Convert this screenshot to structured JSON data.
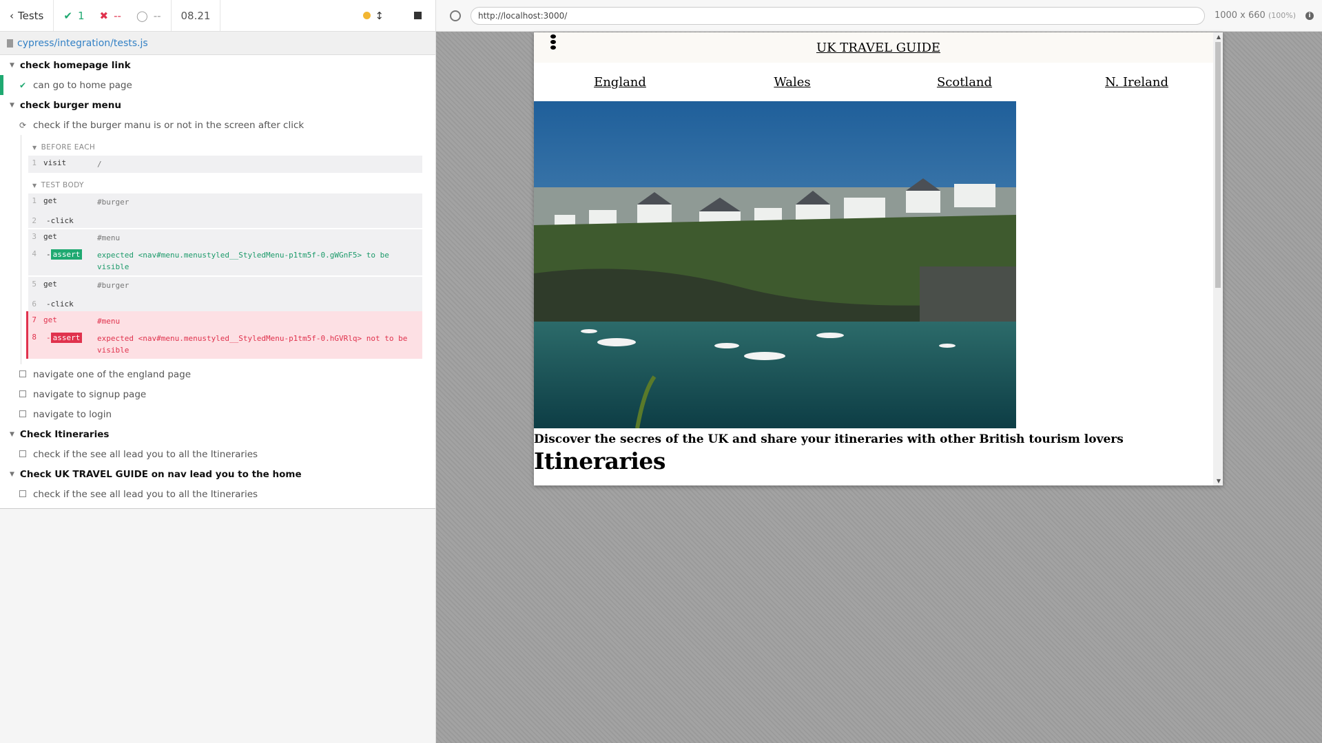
{
  "stats": {
    "back_label": "Tests",
    "passed": "1",
    "failed": "--",
    "pending": "--",
    "duration": "08.21"
  },
  "spec": {
    "path": "cypress/integration/tests.js"
  },
  "tree": {
    "suite1": {
      "title": "check homepage link",
      "test1": "can go to home page"
    },
    "suite2": {
      "title": "check burger menu",
      "test1": "check if the burger manu is or not in the screen after click",
      "hook_before": "BEFORE EACH",
      "hook_body": "TEST BODY",
      "before_cmds": [
        {
          "num": "1",
          "name": "visit",
          "msg": "/"
        }
      ],
      "body_cmds": [
        {
          "num": "1",
          "name": "get",
          "msg": "#burger"
        },
        {
          "num": "2",
          "name": "-click",
          "msg": ""
        },
        {
          "num": "3",
          "name": "get",
          "msg": "#menu"
        },
        {
          "num": "4",
          "name": "assert",
          "msg": "expected <nav#menu.menustyled__StyledMenu-p1tm5f-0.gWGnF5> to be visible"
        },
        {
          "num": "5",
          "name": "get",
          "msg": "#burger"
        },
        {
          "num": "6",
          "name": "-click",
          "msg": ""
        },
        {
          "num": "7",
          "name": "get",
          "msg": "#menu"
        },
        {
          "num": "8",
          "name": "assert",
          "msg": "expected <nav#menu.menustyled__StyledMenu-p1tm5f-0.hGVRlq> not to be visible"
        }
      ],
      "test2": "navigate one of the england page",
      "test3": "navigate to signup page",
      "test4": "navigate to login"
    },
    "suite3": {
      "title": "Check Itineraries",
      "test1": "check if the see all lead you to all the Itineraries"
    },
    "suite4": {
      "title": "Check UK TRAVEL GUIDE on nav lead you to the home",
      "test1": "check if the see all lead you to all the Itineraries"
    }
  },
  "aut": {
    "url": "http://localhost:3000/",
    "viewport": "1000 x 660",
    "zoom": "(100%)"
  },
  "site": {
    "title": "UK TRAVEL GUIDE",
    "nav": [
      "England",
      "Wales",
      "Scotland",
      "N. Ireland"
    ],
    "tagline": "Discover the secres of the UK and share your itineraries with other British tourism lovers",
    "heading": "Itineraries"
  },
  "colors": {
    "pass": "#1fa971",
    "fail": "#e0324d",
    "link": "#3381c5"
  }
}
